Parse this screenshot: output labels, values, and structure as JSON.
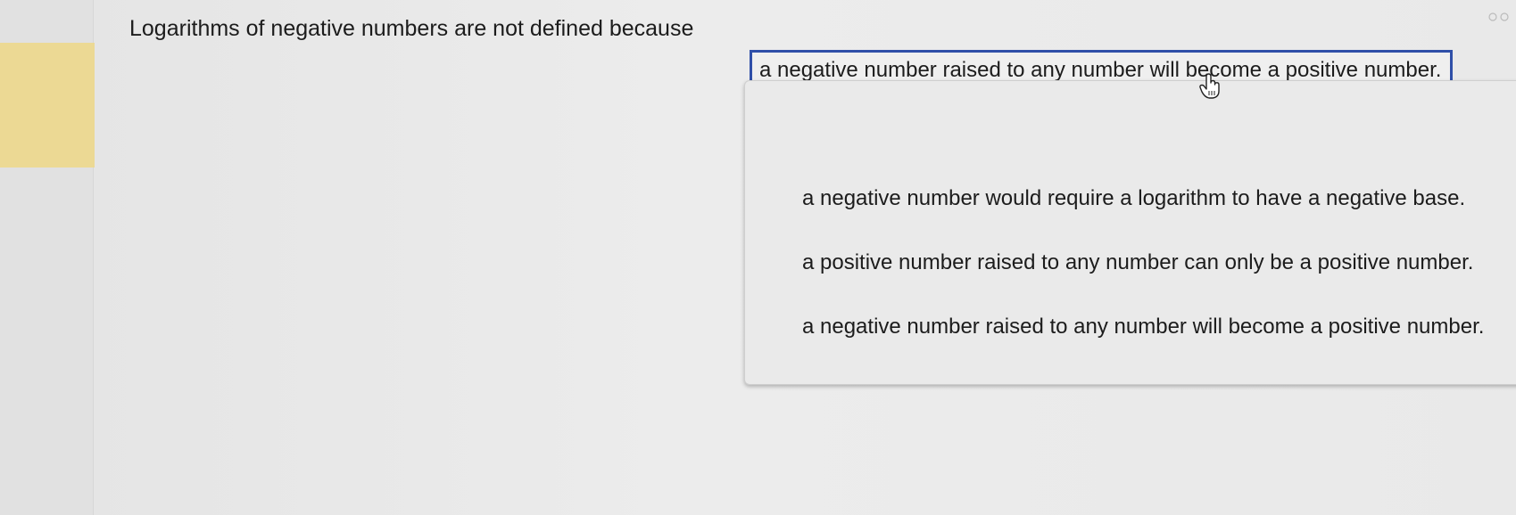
{
  "question": {
    "prompt": "Logarithms of negative numbers are not defined because"
  },
  "dropdown": {
    "selected": "a negative number raised to any number will become a positive number.",
    "options": [
      "a negative number would require a logarithm to have a negative base.",
      "a positive number raised to any number can only be a positive number.",
      "a negative number raised to any number will become a positive number."
    ]
  },
  "colors": {
    "selected_border": "#2f4fa8",
    "marker": "#ecd994"
  }
}
